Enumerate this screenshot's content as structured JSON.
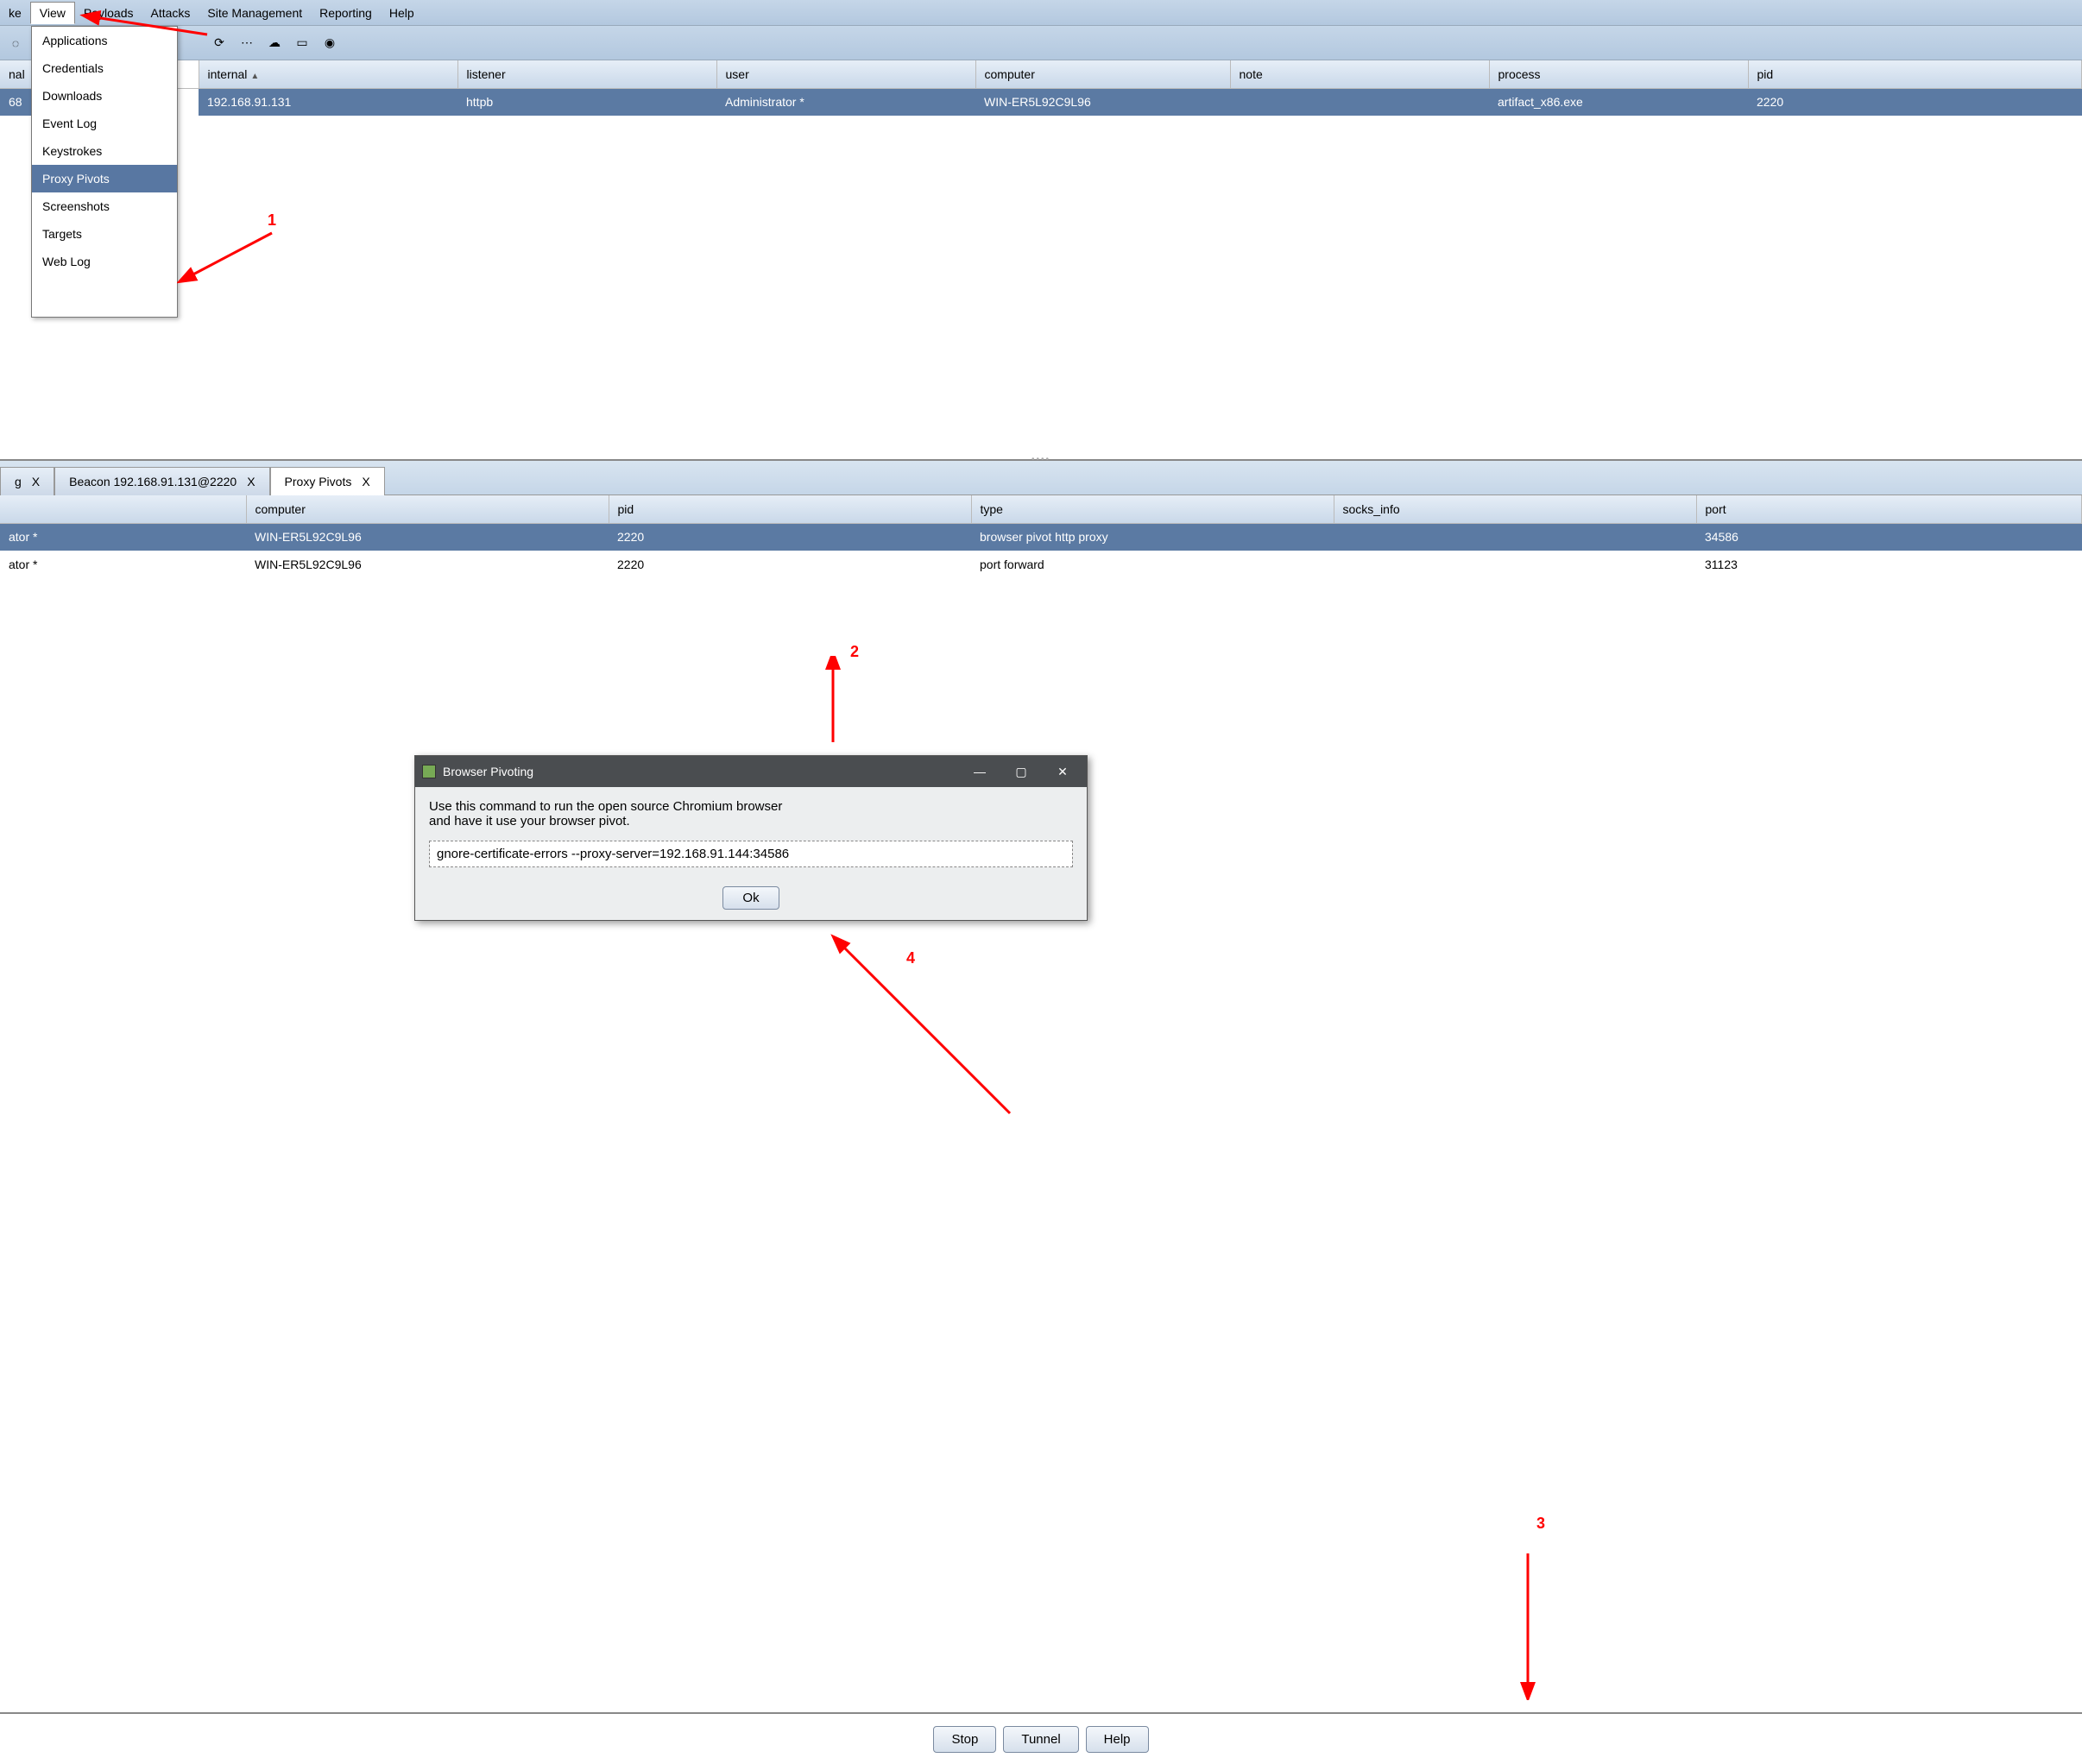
{
  "menu": {
    "items": [
      "ke",
      "View",
      "Payloads",
      "Attacks",
      "Site Management",
      "Reporting",
      "Help"
    ],
    "active_index": 1
  },
  "toolbar_icons": [
    "plus-icon",
    "dots-icon",
    "cloud-icon",
    "rect-icon",
    "camera-icon"
  ],
  "view_dropdown": {
    "items": [
      "Applications",
      "Credentials",
      "Downloads",
      "Event Log",
      "Keystrokes",
      "Proxy Pivots",
      "Screenshots",
      "Targets",
      "Web Log"
    ],
    "selected_index": 5
  },
  "sessions_table": {
    "headers": [
      "nal",
      "internal",
      "listener",
      "user",
      "computer",
      "note",
      "process",
      "pid"
    ],
    "sort_col": "internal",
    "row": {
      "c0": "68",
      "internal": "192.168.91.131",
      "listener": "httpb",
      "user": "Administrator *",
      "computer": "WIN-ER5L92C9L96",
      "note": "",
      "process": "artifact_x86.exe",
      "pid": "2220"
    }
  },
  "tabs": {
    "t0": {
      "label": "g",
      "close": "X"
    },
    "t1": {
      "label": "Beacon 192.168.91.131@2220",
      "close": "X"
    },
    "t2": {
      "label": "Proxy Pivots",
      "close": "X"
    }
  },
  "pivots_table": {
    "headers": [
      "",
      "computer",
      "pid",
      "type",
      "socks_info",
      "port"
    ],
    "rows": [
      {
        "user": "ator *",
        "computer": "WIN-ER5L92C9L96",
        "pid": "2220",
        "type": "browser pivot http proxy",
        "socks": "",
        "port": "34586"
      },
      {
        "user": "ator *",
        "computer": "WIN-ER5L92C9L96",
        "pid": "2220",
        "type": "port forward",
        "socks": "",
        "port": "31123"
      }
    ]
  },
  "dialog": {
    "title": "Browser Pivoting",
    "text1": "Use this command to run the open source Chromium browser",
    "text2": "and have it use your browser pivot.",
    "command": "gnore-certificate-errors --proxy-server=192.168.91.144:34586",
    "ok": "Ok"
  },
  "bottom": {
    "stop": "Stop",
    "tunnel": "Tunnel",
    "help": "Help"
  },
  "ann": {
    "n1": "1",
    "n2": "2",
    "n3": "3",
    "n4": "4"
  }
}
